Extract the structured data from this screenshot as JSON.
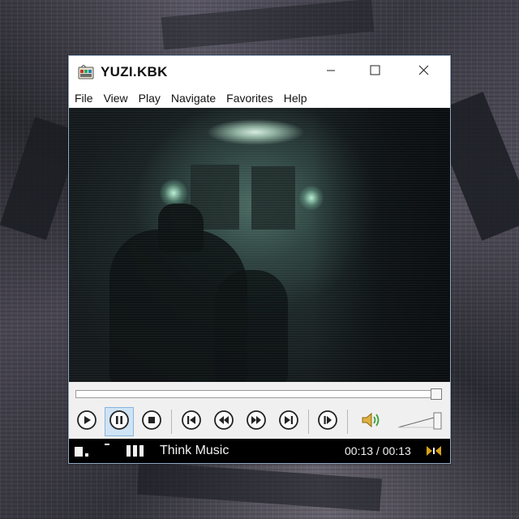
{
  "window": {
    "title": "YUZI.KBK",
    "icon": "media-player-icon",
    "controls": [
      "minimize-icon",
      "maximize-icon",
      "close-icon"
    ]
  },
  "menu": {
    "items": [
      "File",
      "View",
      "Play",
      "Navigate",
      "Favorites",
      "Help"
    ]
  },
  "player": {
    "progress": 1.0,
    "state": "playing",
    "buttons": [
      "play",
      "pause",
      "stop",
      "previous-track",
      "rewind",
      "fast-forward",
      "next-track",
      "frame-step",
      "volume"
    ],
    "volume_level": 1.0
  },
  "status": {
    "track": "Think Music",
    "time": "00:13 / 00:13"
  },
  "colors": {
    "accent": "#2a7ab8",
    "button_active_bg": "#cfe3f5",
    "status_bg": "#000000",
    "status_text": "#f2f2f2"
  }
}
